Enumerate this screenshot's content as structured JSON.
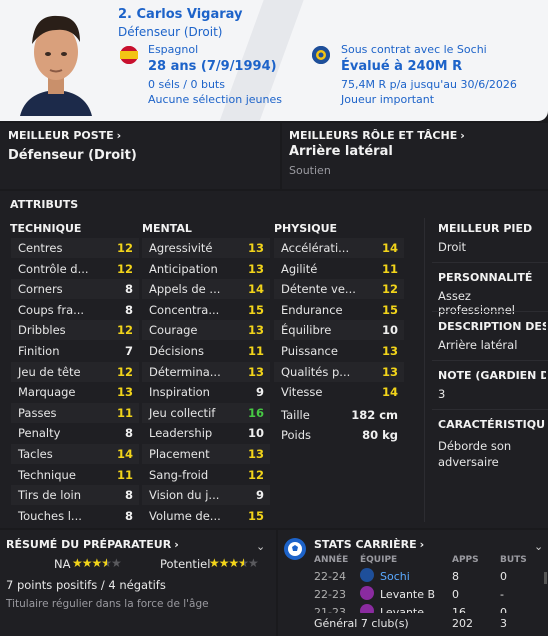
{
  "header": {
    "name": "2. Carlos Vigaray",
    "position": "Défenseur (Droit)",
    "nationality": "Espagnol",
    "age": "28 ans (7/9/1994)",
    "caps": "0 séls / 0 buts",
    "youth": "Aucune sélection jeunes",
    "contract": "Sous contrat avec le Sochi",
    "value": "Évalué à 240M R",
    "wage": "75,4M R p/a jusqu'au 30/6/2026",
    "status": "Joueur important"
  },
  "best_position": {
    "title": "MEILLEUR POSTE",
    "value": "Défenseur (Droit)"
  },
  "best_role": {
    "title": "MEILLEURS RÔLE ET TÂCHE",
    "value": "Arrière latéral",
    "duty": "Soutien"
  },
  "attributes": {
    "title": "ATTRIBUTS",
    "technique_title": "TECHNIQUE",
    "mental_title": "MENTAL",
    "physique_title": "PHYSIQUE",
    "technique": [
      {
        "label": "Centres",
        "value": "12",
        "c": "y"
      },
      {
        "label": "Contrôle d...",
        "value": "12",
        "c": "y"
      },
      {
        "label": "Corners",
        "value": "8",
        "c": "w"
      },
      {
        "label": "Coups fra...",
        "value": "8",
        "c": "w"
      },
      {
        "label": "Dribbles",
        "value": "12",
        "c": "y"
      },
      {
        "label": "Finition",
        "value": "7",
        "c": "w"
      },
      {
        "label": "Jeu de tête",
        "value": "12",
        "c": "y"
      },
      {
        "label": "Marquage",
        "value": "13",
        "c": "y"
      },
      {
        "label": "Passes",
        "value": "11",
        "c": "y"
      },
      {
        "label": "Penalty",
        "value": "8",
        "c": "w"
      },
      {
        "label": "Tacles",
        "value": "14",
        "c": "y"
      },
      {
        "label": "Technique",
        "value": "11",
        "c": "y"
      },
      {
        "label": "Tirs de loin",
        "value": "8",
        "c": "w"
      },
      {
        "label": "Touches l...",
        "value": "8",
        "c": "w"
      }
    ],
    "mental": [
      {
        "label": "Agressivité",
        "value": "13",
        "c": "y"
      },
      {
        "label": "Anticipation",
        "value": "13",
        "c": "y"
      },
      {
        "label": "Appels de ...",
        "value": "14",
        "c": "y"
      },
      {
        "label": "Concentra...",
        "value": "15",
        "c": "y"
      },
      {
        "label": "Courage",
        "value": "13",
        "c": "y"
      },
      {
        "label": "Décisions",
        "value": "11",
        "c": "y"
      },
      {
        "label": "Détermina...",
        "value": "13",
        "c": "y"
      },
      {
        "label": "Inspiration",
        "value": "9",
        "c": "w"
      },
      {
        "label": "Jeu collectif",
        "value": "16",
        "c": "g"
      },
      {
        "label": "Leadership",
        "value": "10",
        "c": "w"
      },
      {
        "label": "Placement",
        "value": "13",
        "c": "y"
      },
      {
        "label": "Sang-froid",
        "value": "12",
        "c": "y"
      },
      {
        "label": "Vision du j...",
        "value": "9",
        "c": "w"
      },
      {
        "label": "Volume de...",
        "value": "15",
        "c": "y"
      }
    ],
    "physique": [
      {
        "label": "Accélérati...",
        "value": "14",
        "c": "y"
      },
      {
        "label": "Agilité",
        "value": "11",
        "c": "y"
      },
      {
        "label": "Détente ve...",
        "value": "12",
        "c": "y"
      },
      {
        "label": "Endurance",
        "value": "15",
        "c": "y"
      },
      {
        "label": "Équilibre",
        "value": "10",
        "c": "w"
      },
      {
        "label": "Puissance",
        "value": "13",
        "c": "y"
      },
      {
        "label": "Qualités p...",
        "value": "13",
        "c": "y"
      },
      {
        "label": "Vitesse",
        "value": "14",
        "c": "y"
      }
    ],
    "height_label": "Taille",
    "height": "182 cm",
    "weight_label": "Poids",
    "weight": "80 kg"
  },
  "right": {
    "foot_title": "MEILLEUR PIED",
    "foot": "Droit",
    "personality_title": "PERSONNALITÉ",
    "personality": "Assez professionnel",
    "desc_title": "DESCRIPTION DES...",
    "desc": "Arrière latéral",
    "gk_title": "NOTE (GARDIEN D...",
    "gk": "3",
    "trait_title": "CARACTÉRISTIQU...",
    "trait": "Déborde son adversaire"
  },
  "coach": {
    "title": "RÉSUMÉ DU PRÉPARATEUR",
    "na": "NA",
    "potential": "Potentiel",
    "ability_stars": 3.5,
    "potential_stars": 3.5,
    "points": "7 points positifs / 4 négatifs",
    "note": "Titulaire régulier dans la force de l'âge"
  },
  "career": {
    "title": "STATS CARRIÈRE",
    "headers": [
      "ANNÉE",
      "ÉQUIPE",
      "APPS",
      "BUTS"
    ],
    "rows": [
      {
        "year": "22-24",
        "team": "Sochi",
        "apps": "8",
        "goals": "0"
      },
      {
        "year": "22-23",
        "team": "Levante B",
        "apps": "0",
        "goals": "-"
      },
      {
        "year": "21-23",
        "team": "Levante",
        "apps": "16",
        "goals": "0"
      }
    ],
    "total_label": "Général 7 club(s)",
    "total_apps": "202",
    "total_goals": "3"
  }
}
